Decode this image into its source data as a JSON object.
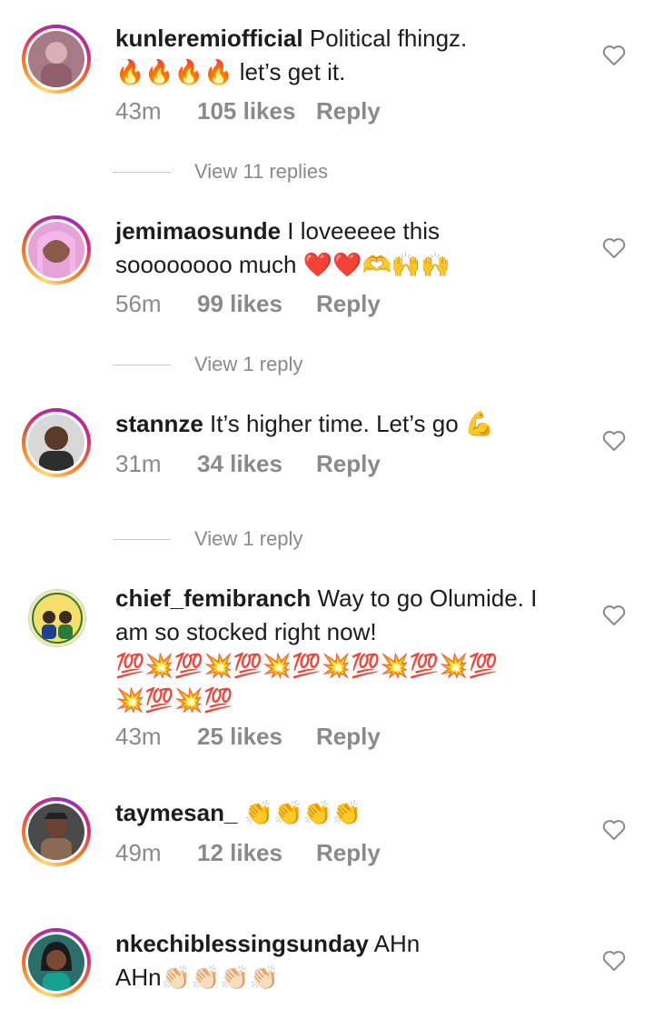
{
  "comments": [
    {
      "username": "kunleremiofficial",
      "text": "Political fhingz.",
      "emoji_line": "🔥🔥🔥🔥",
      "text2": " let’s get it.",
      "time": "43m",
      "likes": "105 likes",
      "reply": "Reply",
      "view_replies": "View 11 replies"
    },
    {
      "username": "jemimaosunde",
      "text": "I loveeeee this",
      "text2": "soooooooo much ",
      "emoji_line": "❤️❤️🫶🙌🙌",
      "time": "56m",
      "likes": "99 likes",
      "reply": "Reply",
      "view_replies": "View 1 reply"
    },
    {
      "username": "stannze",
      "text": "It’s higher time. Let’s go ",
      "emoji_line": "💪",
      "time": "31m",
      "likes": "34 likes",
      "reply": "Reply",
      "view_replies": "View 1 reply"
    },
    {
      "username": "chief_femibranch",
      "text": "Way to go Olumide. I am so stocked right now!",
      "emoji_line": "💯💥💯💥💯💥💯💥💯💥💯💥💯",
      "emoji_line2": "💥💯💥💯",
      "time": "43m",
      "likes": "25 likes",
      "reply": "Reply"
    },
    {
      "username": "taymesan_",
      "text": "",
      "emoji_line": "👏👏👏👏",
      "time": "49m",
      "likes": "12 likes",
      "reply": "Reply"
    },
    {
      "username": "nkechiblessingsunday",
      "text": "AHn",
      "text2": "AHn",
      "emoji_line": "👏🏻👏🏻👏🏻👏🏻"
    }
  ]
}
